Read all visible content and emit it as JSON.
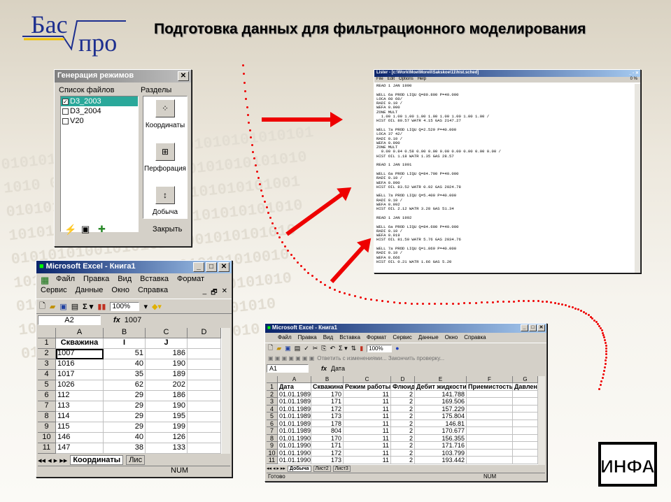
{
  "slide": {
    "title": "Подготовка данных для фильтрационного моделирования",
    "logo_left": "Бас",
    "logo_right": "про",
    "corner_logo": "ИНФА"
  },
  "bg_digits": "0101010100101010101001010101010101\n1010 0101010101001010101010101010\n01010101010100101010101010101001\n1010101010010101 010101010101010\n0101010100101010101001010101010\n101010101001010101010101010010\n010101010100101010101010101010\n1010101010010101010010101010\n01010101001010101010101010",
  "gen_dialog": {
    "title": "Генерация режимов",
    "files_label": "Список файлов",
    "sections_label": "Разделы",
    "files": [
      {
        "name": "D3_2003",
        "checked": true,
        "selected": true
      },
      {
        "name": "D3_2004",
        "checked": false,
        "selected": false
      },
      {
        "name": "V20",
        "checked": false,
        "selected": false
      }
    ],
    "sections": [
      {
        "label": "Координаты",
        "icon": "coordinates-icon"
      },
      {
        "label": "Перфорация",
        "icon": "perforation-icon"
      },
      {
        "label": "Добыча",
        "icon": "production-icon"
      }
    ],
    "close_label": "Закрыть"
  },
  "lister": {
    "title": "Lister - [c:\\Work\\Мои\\Moreli\\Sakskoe\\11\\hist.sched]",
    "menu": [
      "File",
      "Edit",
      "Options",
      "Help"
    ],
    "percent": "0 %",
    "lines": [
      "READ 1 JAN 1990",
      "",
      "WELL 6a PROD LIQU Q=89.800 P=40.000",
      "LOCA 60 60/",
      "RADI 0.10 /",
      "WEFA 0.900",
      "ZONE MULT",
      "  1.00 1.00 1.00 1.00 1.00 1.00 1.00 1.00 1.00 /",
      "HIST OIL 80.57 WATR 4.15 GAS 2147.27",
      "",
      "WELL 7a PROD LIQU Q=2.529 P=40.000",
      "LOCA 37 42/",
      "RADI 0.10 /",
      "WEFA 0.990",
      "ZONE MULT",
      "  0.00 0.84 0.58 0.00 0.00 0.00 0.00 0.00 0.00 0.00 /",
      "HIST OIL 1.18 WATR 1.35 GAS 28.57",
      "",
      "READ 1 JAN 1991",
      "",
      "WELL 6a PROD LIQU Q=84.700 P=40.000",
      "RADI 0.10 /",
      "WEFA 0.990",
      "HIST OIL 83.52 WATR 0.92 GAS 2024.78",
      "",
      "WELL 7a PROD LIQU Q=5.400 P=40.000",
      "RADI 0.10 /",
      "WEFA 0.992",
      "HIST OIL 2.12 WATR 3.28 GAS 51.34",
      "",
      "READ 1 JAN 1992",
      "",
      "WELL 6a PROD LIQU Q=84.600 P=40.000",
      "RADI 0.10 /",
      "WEFA 0.919",
      "HIST OIL 81.50 WATR 5.76 GAS 2034.76",
      "",
      "WELL 7a PROD LIQU Q=1.869 P=40.000",
      "RADI 0.10 /",
      "WEFA 0.666",
      "HIST OIL 0.21 WATR 1.66 GAS 5.20"
    ]
  },
  "excel1": {
    "title": "Microsoft Excel - Книга1",
    "menu1": [
      "Файл",
      "Правка",
      "Вид",
      "Вставка",
      "Формат"
    ],
    "menu2": [
      "Сервис",
      "Данные",
      "Окно",
      "Справка"
    ],
    "zoom": "100%",
    "namebox": "A2",
    "formula": "1007",
    "fx": "fx",
    "cols": [
      "A",
      "B",
      "C",
      "D"
    ],
    "rows": [
      [
        "1",
        "Скважина",
        "I",
        "J",
        ""
      ],
      [
        "2",
        "1007",
        "51",
        "186",
        ""
      ],
      [
        "3",
        "1016",
        "40",
        "190",
        ""
      ],
      [
        "4",
        "1017",
        "35",
        "189",
        ""
      ],
      [
        "5",
        "1026",
        "62",
        "202",
        ""
      ],
      [
        "6",
        "112",
        "29",
        "186",
        ""
      ],
      [
        "7",
        "113",
        "29",
        "190",
        ""
      ],
      [
        "8",
        "114",
        "29",
        "195",
        ""
      ],
      [
        "9",
        "115",
        "29",
        "199",
        ""
      ],
      [
        "10",
        "146",
        "40",
        "126",
        ""
      ],
      [
        "11",
        "147",
        "38",
        "133",
        ""
      ]
    ],
    "tabs": [
      "Координаты",
      "Лис"
    ],
    "status": "NUM"
  },
  "excel2": {
    "title": "Microsoft Excel - Книга1",
    "menu": [
      "Файл",
      "Правка",
      "Вид",
      "Вставка",
      "Формат",
      "Сервис",
      "Данные",
      "Окно",
      "Справка"
    ],
    "zoom": "100%",
    "review": "Ответить с изменениями... Закончить проверку...",
    "namebox": "A1",
    "formula": "Дата",
    "fx": "fx",
    "cols": [
      "A",
      "B",
      "C",
      "D",
      "E",
      "F",
      "G"
    ],
    "rows": [
      [
        "1",
        "Дата",
        "Скважина",
        "Режим работы",
        "Флюид",
        "Дебит жидкости",
        "Приемистость",
        "Давлени"
      ],
      [
        "2",
        "01.01.1989",
        "170",
        "11",
        "2",
        "141.788",
        "",
        ""
      ],
      [
        "3",
        "01.01.1989",
        "171",
        "11",
        "2",
        "169.506",
        "",
        ""
      ],
      [
        "4",
        "01.01.1989",
        "172",
        "11",
        "2",
        "157.229",
        "",
        ""
      ],
      [
        "5",
        "01.01.1989",
        "173",
        "11",
        "2",
        "175.804",
        "",
        ""
      ],
      [
        "6",
        "01.01.1989",
        "178",
        "11",
        "2",
        "146.81",
        "",
        ""
      ],
      [
        "7",
        "01.01.1989",
        "804",
        "11",
        "2",
        "170.677",
        "",
        ""
      ],
      [
        "8",
        "01.01.1990",
        "170",
        "11",
        "2",
        "156.355",
        "",
        ""
      ],
      [
        "9",
        "01.01.1990",
        "171",
        "11",
        "2",
        "171.716",
        "",
        ""
      ],
      [
        "10",
        "01.01.1990",
        "172",
        "11",
        "2",
        "103.799",
        "",
        ""
      ],
      [
        "11",
        "01.01.1990",
        "173",
        "11",
        "2",
        "193.442",
        "",
        ""
      ]
    ],
    "tabs": [
      "Добыча",
      "Лист2",
      "Лист3"
    ],
    "status_left": "Готово",
    "status_right": "NUM"
  },
  "colors": {
    "arrow": "#ee0000",
    "title_bar": "#0a246a",
    "selection": "#2aa89a"
  }
}
